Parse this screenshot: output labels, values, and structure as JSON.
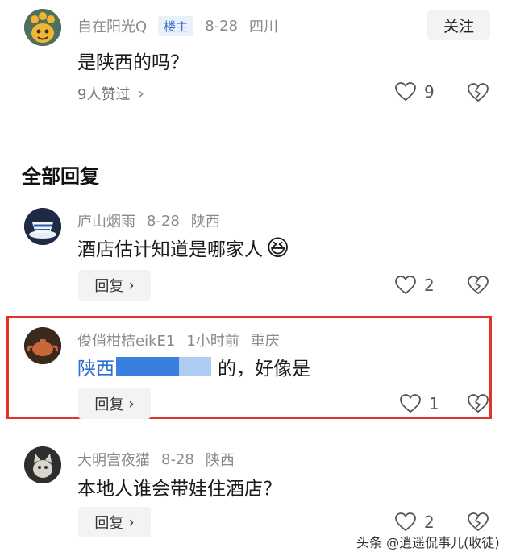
{
  "top_comment": {
    "username": "自在阳光Q",
    "badge": "楼主",
    "date": "8-28",
    "location": "四川",
    "follow_label": "关注",
    "text": "是陕西的吗？",
    "likers_text": "9人赞过",
    "like_count": "9"
  },
  "section_title": "全部回复",
  "replies": [
    {
      "username": "庐山烟雨",
      "date": "8-28",
      "location": "陕西",
      "text": "酒店估计知道是哪家人",
      "emoji": "😆",
      "reply_label": "回复",
      "like_count": "2"
    },
    {
      "username": "俊俏柑桔eikE1",
      "date": "1小时前",
      "location": "重庆",
      "text_prefix": "陕西",
      "text_suffix": "的，好像是",
      "reply_label": "回复",
      "like_count": "1"
    },
    {
      "username": "大明宫夜猫",
      "date": "8-28",
      "location": "陕西",
      "text": "本地人谁会带娃住酒店？",
      "reply_label": "回复",
      "like_count": "2"
    }
  ],
  "watermark": "头条 @逍遥侃事儿(收徒)",
  "colors": {
    "highlight": "#e3312b",
    "link_blue": "#2f6dd0",
    "badge_bg": "#eaf1fb"
  }
}
